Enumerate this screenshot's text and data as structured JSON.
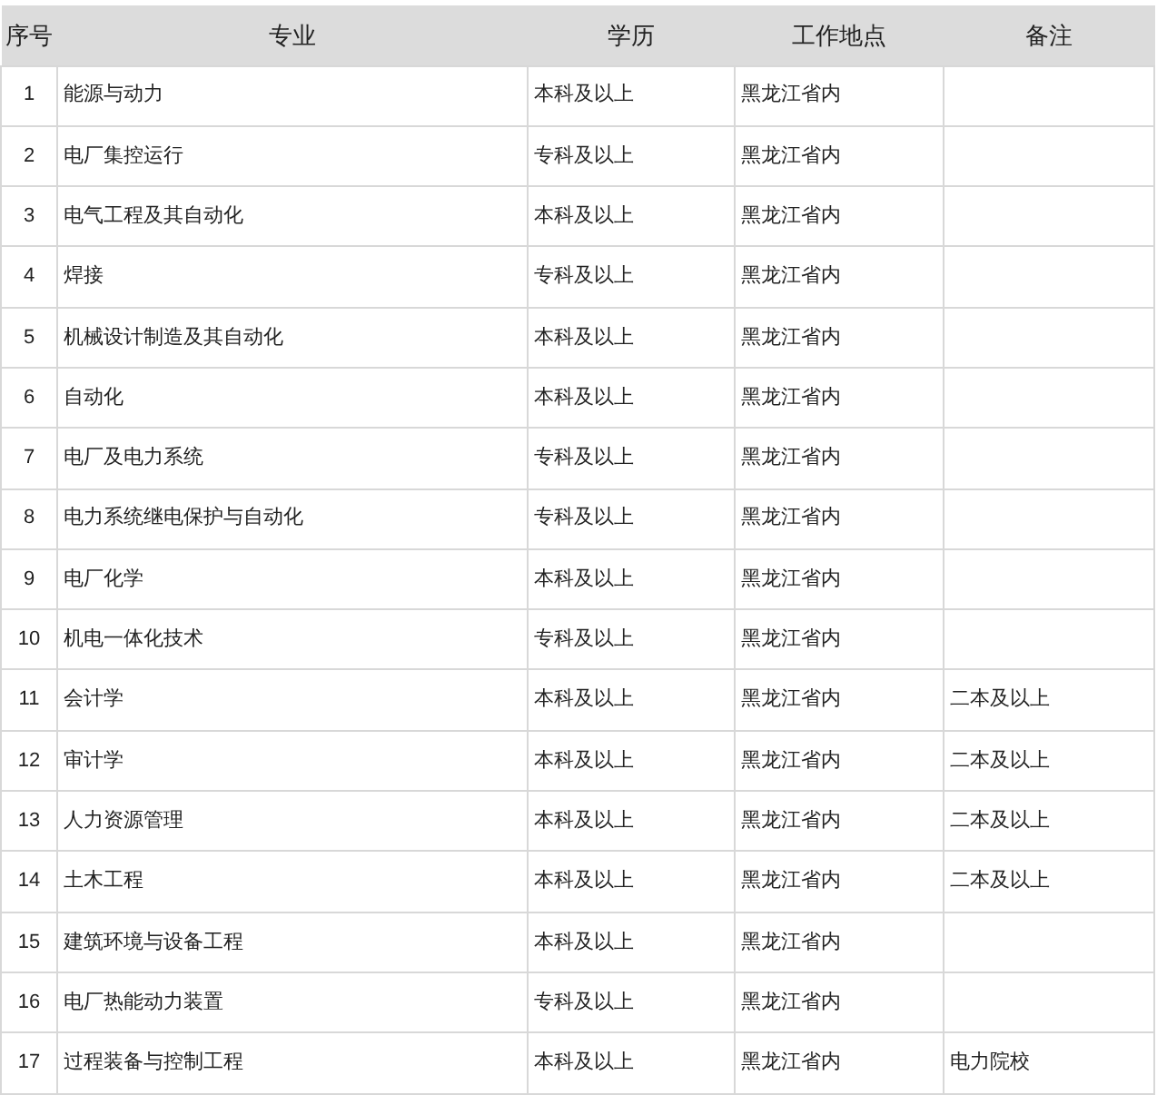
{
  "table": {
    "columns": [
      "序号",
      "专业",
      "学历",
      "工作地点",
      "备注"
    ],
    "rows": [
      {
        "number": "1",
        "major": "能源与动力",
        "education": "本科及以上",
        "location": "黑龙江省内"
      },
      {
        "number": "2",
        "major": "电厂集控运行",
        "education": "专科及以上",
        "location": "黑龙江省内"
      },
      {
        "number": "3",
        "major": "电气工程及其自动化",
        "education": "本科及以上",
        "location": "黑龙江省内"
      },
      {
        "number": "4",
        "major": "焊接",
        "education": "专科及以上",
        "location": "黑龙江省内"
      },
      {
        "number": "5",
        "major": "机械设计制造及其自动化",
        "education": "本科及以上",
        "location": "黑龙江省内"
      },
      {
        "number": "6",
        "major": "自动化",
        "education": "本科及以上",
        "location": "黑龙江省内"
      },
      {
        "number": "7",
        "major": "电厂及电力系统",
        "education": "专科及以上",
        "location": "黑龙江省内"
      },
      {
        "number": "8",
        "major": "电力系统继电保护与自动化",
        "education": "专科及以上",
        "location": "黑龙江省内"
      },
      {
        "number": "9",
        "major": "电厂化学",
        "education": "本科及以上",
        "location": "黑龙江省内"
      },
      {
        "number": "10",
        "major": "机电一体化技术",
        "education": "专科及以上",
        "location": "黑龙江省内"
      },
      {
        "number": "11",
        "major": "会计学",
        "education": "本科及以上",
        "location": "黑龙江省内",
        "remarks": "二本及以上"
      },
      {
        "number": "12",
        "major": "审计学",
        "education": "本科及以上",
        "location": "黑龙江省内",
        "remarks": "二本及以上"
      },
      {
        "number": "13",
        "major": "人力资源管理",
        "education": "本科及以上",
        "location": "黑龙江省内",
        "remarks": "二本及以上"
      },
      {
        "number": "14",
        "major": "土木工程",
        "education": "本科及以上",
        "location": "黑龙江省内",
        "remarks": "二本及以上"
      },
      {
        "number": "15",
        "major": "建筑环境与设备工程",
        "education": "本科及以上",
        "location": "黑龙江省内"
      },
      {
        "number": "16",
        "major": "电厂热能动力装置",
        "education": "专科及以上",
        "location": "黑龙江省内"
      },
      {
        "number": "17",
        "major": "过程装备与控制工程",
        "education": "本科及以上",
        "location": "黑龙江省内",
        "remarks": "电力院校"
      }
    ]
  }
}
